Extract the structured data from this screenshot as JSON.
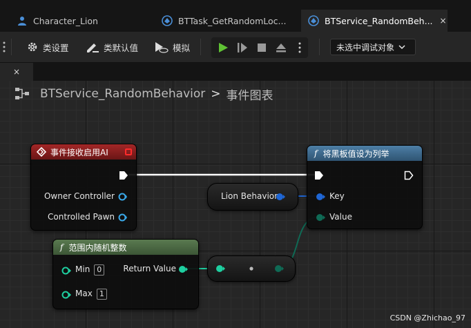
{
  "tabs": [
    {
      "label": "Character_Lion",
      "icon": "character-blueprint-icon"
    },
    {
      "label": "BTTask_GetRandomLoc...",
      "icon": "blueprint-icon"
    },
    {
      "label": "BTService_RandomBeh...",
      "icon": "blueprint-icon",
      "active": true,
      "close": "×"
    }
  ],
  "toolbar": {
    "class_settings": "类设置",
    "class_defaults": "类默认值",
    "simulate": "模拟",
    "debug_dropdown": "未选中调试对象"
  },
  "subtab": {
    "close": "×"
  },
  "breadcrumb": {
    "blueprint": "BTService_RandomBehavior",
    "separator": ">",
    "graph": "事件图表"
  },
  "nodes": {
    "event": {
      "title": "事件接收启用AI",
      "pins": [
        "Owner Controller",
        "Controlled Pawn"
      ],
      "header_color": "#8e1f1f"
    },
    "set_enum": {
      "func_symbol": "f",
      "title": "将黑板值设为列举",
      "pins": [
        "Key",
        "Value"
      ],
      "header_color": "#3f6a8a"
    },
    "lion_behavior": {
      "label": "Lion Behavior"
    },
    "random_int": {
      "func_symbol": "f",
      "title": "范围内随机整数",
      "min_label": "Min",
      "min_value": "0",
      "max_label": "Max",
      "max_value": "1",
      "return_label": "Return Value",
      "header_color": "#4f6a44"
    }
  },
  "colors": {
    "exec": "#ffffff",
    "object_pin": "#3aa8e8",
    "struct_pin": "#1f66d4",
    "int_pin": "#1ecfa0",
    "enum_wire": "#0f6a55"
  },
  "watermark": "CSDN @Zhichao_97"
}
